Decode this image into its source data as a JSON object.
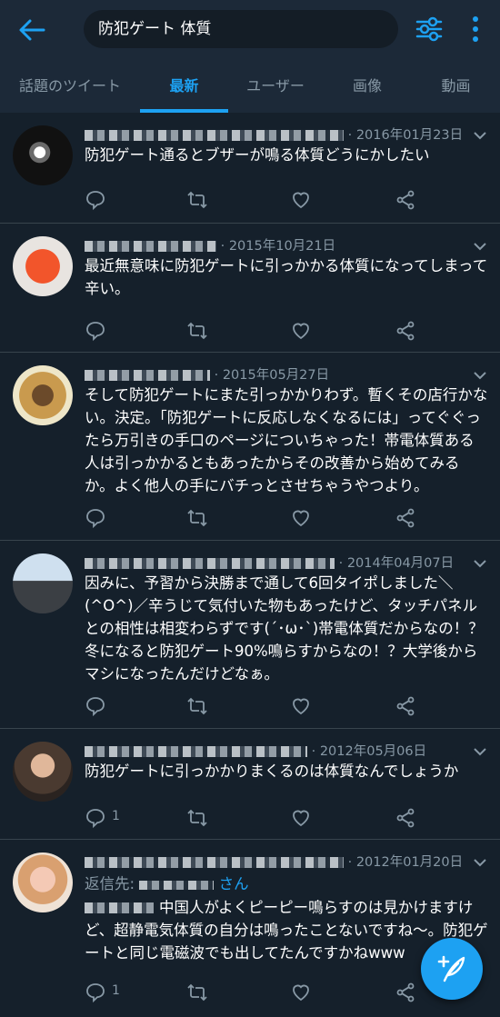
{
  "search": {
    "query": "防犯ゲート 体質"
  },
  "tabs": [
    "話題のツイート",
    "最新",
    "ユーザー",
    "画像",
    "動画"
  ],
  "active_tab": "最新",
  "colors": {
    "accent": "#1da1f2",
    "background": "#15202b",
    "header": "#1c2938",
    "muted": "#8899a6"
  },
  "tweets": [
    {
      "date": "· 2016年01月23日",
      "text": "防犯ゲート通るとブザーが鳴る体質どうにかしたい",
      "reply_count": ""
    },
    {
      "date": "· 2015年10月21日",
      "text": "最近無意味に防犯ゲートに引っかかる体質になってしまって辛い。",
      "reply_count": ""
    },
    {
      "date": "· 2015年05月27日",
      "text": "そして防犯ゲートにまた引っかかりわず。暫くその店行かない。決定。「防犯ゲートに反応しなくなるには」ってぐぐったら万引きの手口のページについちゃった！帯電体質ある人は引っかかるともあったからその改善から始めてみるか。よく他人の手にバチっとさせちゃうやつより。",
      "reply_count": ""
    },
    {
      "date": "· 2014年04月07日",
      "text": "因みに、予習から決勝まで通して6回タイポしました＼(^O^)／辛うじて気付いた物もあったけど、タッチパネルとの相性は相変わらずです(´･ω･`)帯電体質だからなの！？冬になると防犯ゲート90%鳴らすからなの！？大学後からマシになったんだけどなぁ。",
      "reply_count": ""
    },
    {
      "date": "· 2012年05月06日",
      "text": "防犯ゲートに引っかかりまくるのは体質なんでしょうか",
      "reply_count": "1"
    },
    {
      "date": "· 2012年01月20日",
      "reply_prefix": "返信先:",
      "reply_suffix": "さん",
      "text": "中国人がよくピーピー鳴らすのは見かけますけど、超静電気体質の自分は鳴ったことないですね〜。防犯ゲートと同じ電磁波でも出してたんですかねwww",
      "reply_count": "1"
    }
  ]
}
